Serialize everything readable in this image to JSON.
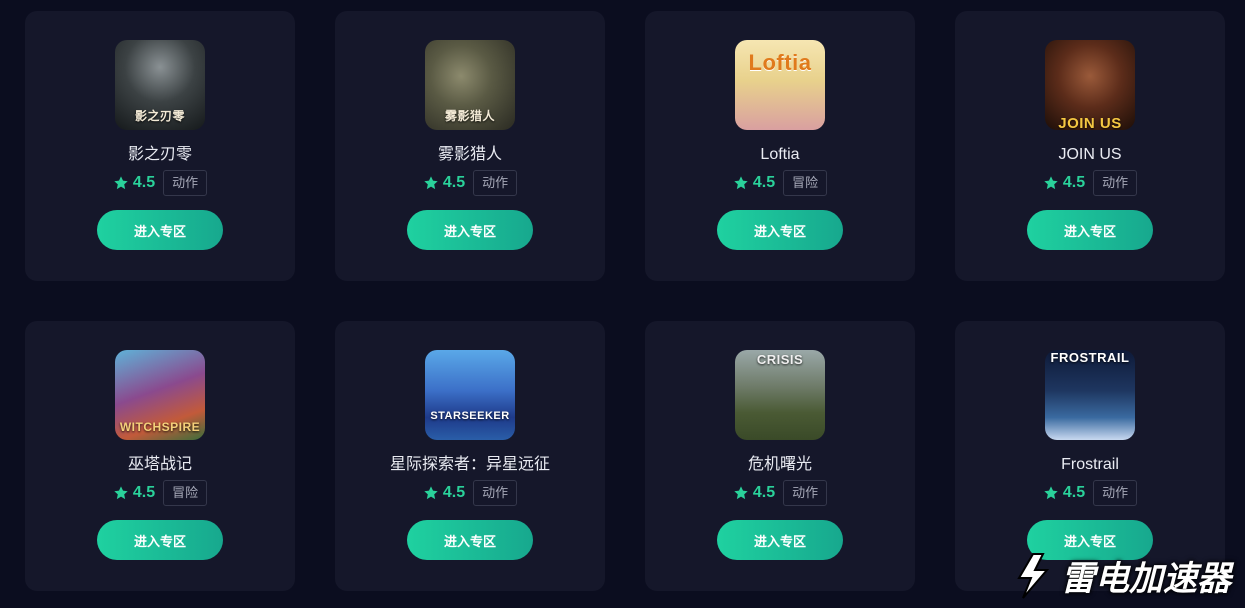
{
  "games": [
    {
      "title": "影之刃零",
      "rating": "4.5",
      "tag": "动作",
      "button": "进入专区",
      "art": "blade",
      "art_caption": "影之刃零"
    },
    {
      "title": "雾影猎人",
      "rating": "4.5",
      "tag": "动作",
      "button": "进入专区",
      "art": "fog",
      "art_caption": "雾影猎人"
    },
    {
      "title": "Loftia",
      "rating": "4.5",
      "tag": "冒险",
      "button": "进入专区",
      "art": "loftia",
      "art_caption": "Loftia"
    },
    {
      "title": "JOIN US",
      "rating": "4.5",
      "tag": "动作",
      "button": "进入专区",
      "art": "joinus",
      "art_caption": "JOIN US"
    },
    {
      "title": "巫塔战记",
      "rating": "4.5",
      "tag": "冒险",
      "button": "进入专区",
      "art": "witch",
      "art_caption": "WITCHSPIRE"
    },
    {
      "title": "星际探索者：异星远征",
      "rating": "4.5",
      "tag": "动作",
      "button": "进入专区",
      "art": "star",
      "art_caption": "STARSEEKER"
    },
    {
      "title": "危机曙光",
      "rating": "4.5",
      "tag": "动作",
      "button": "进入专区",
      "art": "crisis",
      "art_caption": "CRISIS"
    },
    {
      "title": "Frostrail",
      "rating": "4.5",
      "tag": "动作",
      "button": "进入专区",
      "art": "frost",
      "art_caption": "FROSTRAIL"
    }
  ],
  "watermark": {
    "text": "雷电加速器",
    "icon": "lightning-logo-icon"
  },
  "colors": {
    "accent": "#1fd1a0",
    "card_bg": "#15172a",
    "page_bg": "#0b0d1f"
  }
}
